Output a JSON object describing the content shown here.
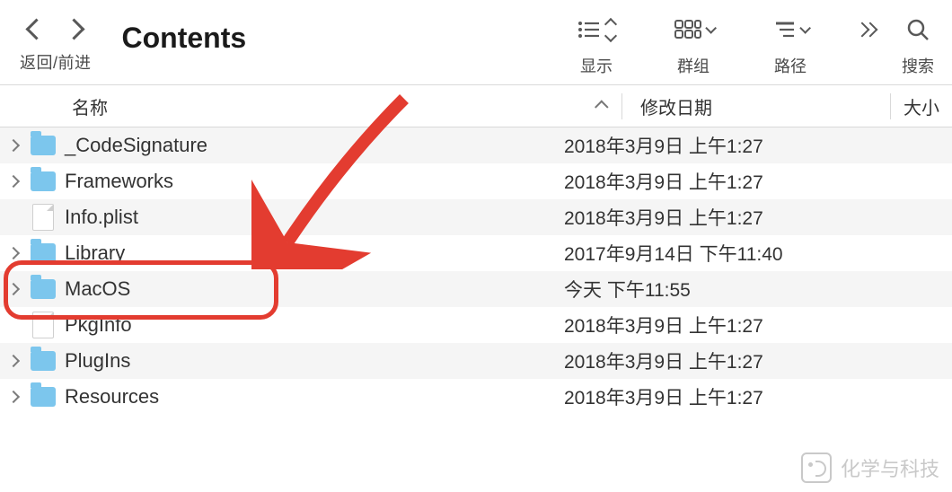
{
  "window": {
    "title": "Contents"
  },
  "toolbar": {
    "nav_label": "返回/前进",
    "view_label": "显示",
    "group_label": "群组",
    "path_label": "路径",
    "search_label": "搜索"
  },
  "columns": {
    "name": "名称",
    "modified": "修改日期",
    "size": "大小"
  },
  "files": [
    {
      "name": "_CodeSignature",
      "type": "folder",
      "modified": "2018年3月9日 上午1:27"
    },
    {
      "name": "Frameworks",
      "type": "folder",
      "modified": "2018年3月9日 上午1:27"
    },
    {
      "name": "Info.plist",
      "type": "file",
      "modified": "2018年3月9日 上午1:27"
    },
    {
      "name": "Library",
      "type": "folder",
      "modified": "2017年9月14日 下午11:40"
    },
    {
      "name": "MacOS",
      "type": "folder",
      "modified": "今天 下午11:55"
    },
    {
      "name": "PkgInfo",
      "type": "file",
      "modified": "2018年3月9日 上午1:27"
    },
    {
      "name": "PlugIns",
      "type": "folder",
      "modified": "2018年3月9日 上午1:27"
    },
    {
      "name": "Resources",
      "type": "folder",
      "modified": "2018年3月9日 上午1:27"
    }
  ],
  "annotation": {
    "highlight_index": 4,
    "arrow_color": "#e33c30"
  },
  "watermark": {
    "text": "化学与科技"
  }
}
